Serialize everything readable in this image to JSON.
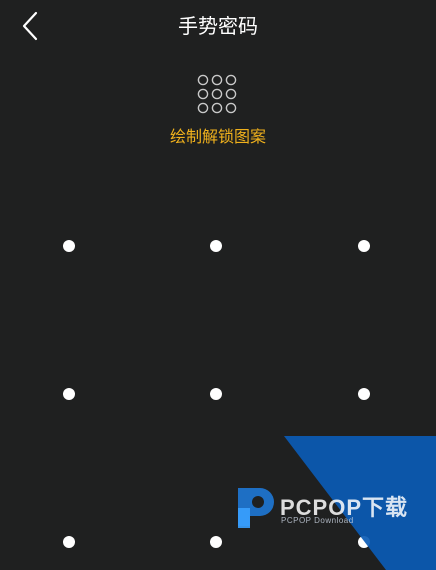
{
  "header": {
    "title": "手势密码",
    "back_icon": "chevron-left-icon"
  },
  "prompt": {
    "indicator_icon": "pattern-grid-icon",
    "hint": "绘制解锁图案"
  },
  "pattern": {
    "rows": 3,
    "cols": 3
  },
  "watermark": {
    "brand": "PCPOP下载",
    "tagline": "PCPOP Download"
  },
  "colors": {
    "background": "#1f2020",
    "accent": "#f0b11c",
    "dot": "#ffffff",
    "watermark_blue": "#0b5bb5"
  }
}
